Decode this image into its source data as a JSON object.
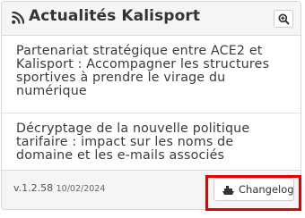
{
  "header": {
    "title": "Actualités Kalisport",
    "title_icon": "rss-icon",
    "zoom_icon": "zoom-in-icon"
  },
  "news": [
    {
      "title": "Partenariat stratégique entre ACE2 et Kalisport : Accompagner les structures sportives à prendre le virage du numérique"
    },
    {
      "title": "Décryptage de la nouvelle politique tarifaire : impact sur les noms de domaine et les e-mails associés"
    }
  ],
  "footer": {
    "version": "v.1.2.58",
    "date": "10/02/2024",
    "changelog_label": "Changelog",
    "changelog_icon": "ship-icon"
  },
  "colors": {
    "highlight": "#e00000",
    "panel_header_bg": "#f5f5f5",
    "text": "#333333"
  }
}
